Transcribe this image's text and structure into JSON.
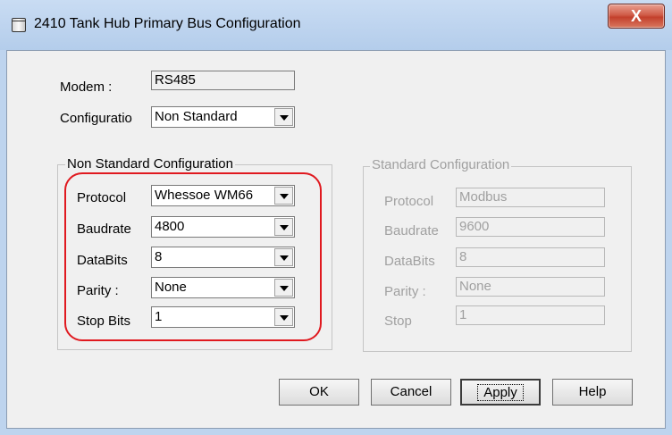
{
  "window": {
    "title": "2410 Tank Hub Primary Bus Configuration",
    "close_label": "X"
  },
  "top": {
    "modem_label": "Modem :",
    "modem_value": "RS485",
    "config_label": "Configuratio",
    "config_value": "Non Standard"
  },
  "non_standard": {
    "title": "Non Standard Configuration",
    "protocol_label": "Protocol",
    "protocol_value": "Whessoe WM66",
    "baudrate_label": "Baudrate",
    "baudrate_value": "4800",
    "databits_label": "DataBits",
    "databits_value": "8",
    "parity_label": "Parity :",
    "parity_value": "None",
    "stopbits_label": "Stop Bits",
    "stopbits_value": "1"
  },
  "standard": {
    "title": "Standard Configuration",
    "protocol_label": "Protocol",
    "protocol_value": "Modbus",
    "baudrate_label": "Baudrate",
    "baudrate_value": "9600",
    "databits_label": "DataBits",
    "databits_value": "8",
    "parity_label": "Parity :",
    "parity_value": "None",
    "stop_label": "Stop",
    "stop_value": "1"
  },
  "buttons": {
    "ok": "OK",
    "cancel": "Cancel",
    "apply": "Apply",
    "help": "Help"
  },
  "colors": {
    "highlight": "#e0191f",
    "close_button": "#c3402c",
    "title_bar": "#bed4ee"
  }
}
